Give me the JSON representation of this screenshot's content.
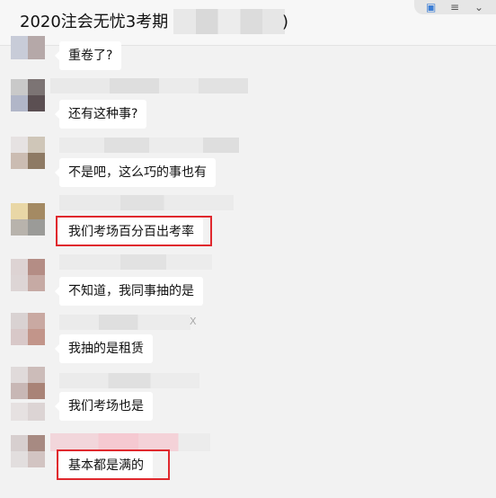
{
  "chat": {
    "title": "2020注会无忧3考期",
    "title_suffix": ")"
  },
  "toolbar": {
    "icons": [
      "chat-icon",
      "menu-icon",
      "collapse-icon"
    ]
  },
  "messages": [
    {
      "text": "重卷了?"
    },
    {
      "text": "还有这种事?"
    },
    {
      "text": "不是吧，这么巧的事也有"
    },
    {
      "text": "我们考场百分百出考率",
      "highlighted": true
    },
    {
      "text": "不知道，我同事抽的是"
    },
    {
      "text": "我抽的是租赁"
    },
    {
      "text": "我们考场也是"
    },
    {
      "text": "基本都是满的",
      "highlighted": true
    }
  ],
  "name_fragments": [
    {
      "text": "X"
    }
  ],
  "colors": {
    "highlight": "#e0282d",
    "bubble": "#ffffff",
    "background": "#f2f2f2"
  }
}
